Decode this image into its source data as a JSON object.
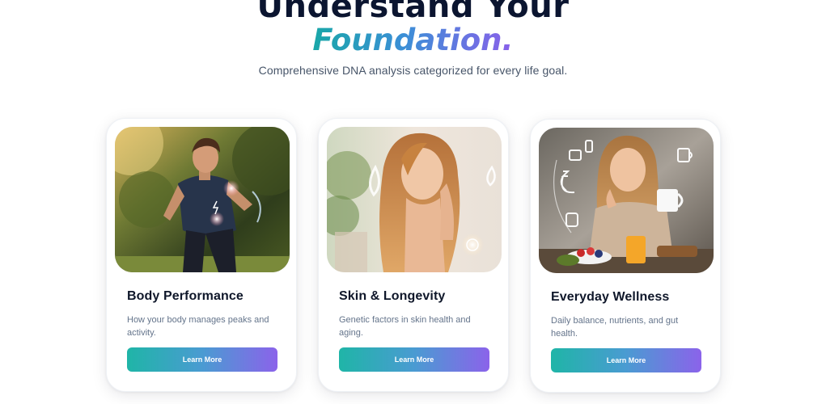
{
  "hero": {
    "title_line1": "Understand Your",
    "title_line2": "Foundation.",
    "subtitle": "Comprehensive DNA analysis categorized for every life goal."
  },
  "cards": [
    {
      "title": "Body Performance",
      "description": "How your body manages peaks and activity.",
      "button": "Learn More",
      "image": "man-running-outdoors-photo"
    },
    {
      "title": "Skin & Longevity",
      "description": "Genetic factors in skin health and aging.",
      "button": "Learn More",
      "image": "woman-touching-face-photo"
    },
    {
      "title": "Everyday Wellness",
      "description": "Daily balance, nutrients, and gut health.",
      "button": "Learn More",
      "image": "woman-with-coffee-breakfast-photo"
    }
  ],
  "colors": {
    "heading": "#0b1530",
    "gradient_start": "#1fb5a7",
    "gradient_end": "#8b63ea",
    "muted_text": "#64748b"
  }
}
